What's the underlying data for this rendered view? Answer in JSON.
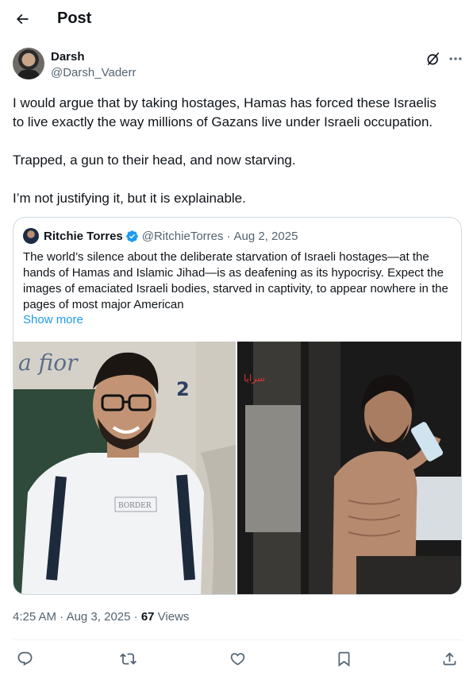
{
  "header": {
    "title": "Post",
    "back_icon": "arrow-left-icon"
  },
  "author": {
    "name": "Darsh",
    "handle": "@Darsh_Vaderr",
    "avatar_icon": "avatar",
    "grok_icon": "grok-icon",
    "more_icon": "more-horizontal-icon"
  },
  "post": {
    "text": "I would argue that by taking hostages, Hamas has forced these Israelis\nto live exactly the way millions of Gazans live under Israeli occupation.\n\nTrapped, a gun to their head, and now starving.\n\nI’m not justifying it, but it is explainable."
  },
  "quote": {
    "name": "Ritchie Torres",
    "verified_icon": "verified-badge-icon",
    "handle": "@RitchieTorres",
    "separator": "·",
    "date": "Aug 2, 2025",
    "text": "The world’s silence about the deliberate starvation of Israeli hostages—at the hands of Hamas and Islamic Jihad—is as deafening as its hypocrisy.  Expect the images of emaciated Israeli bodies, starved in captivity, to appear nowhere in the pages of most major American",
    "show_more": "Show more"
  },
  "meta": {
    "time": "4:25 AM",
    "separator": "·",
    "date": "Aug 3, 2025",
    "views_count": "67",
    "views_label": "Views"
  },
  "actions": {
    "reply_icon": "reply-icon",
    "repost_icon": "repost-icon",
    "like_icon": "like-icon",
    "bookmark_icon": "bookmark-icon",
    "share_icon": "share-icon"
  },
  "colors": {
    "text": "#0f1419",
    "secondary": "#536471",
    "link": "#1d9bf0",
    "border": "#cfd9de"
  }
}
